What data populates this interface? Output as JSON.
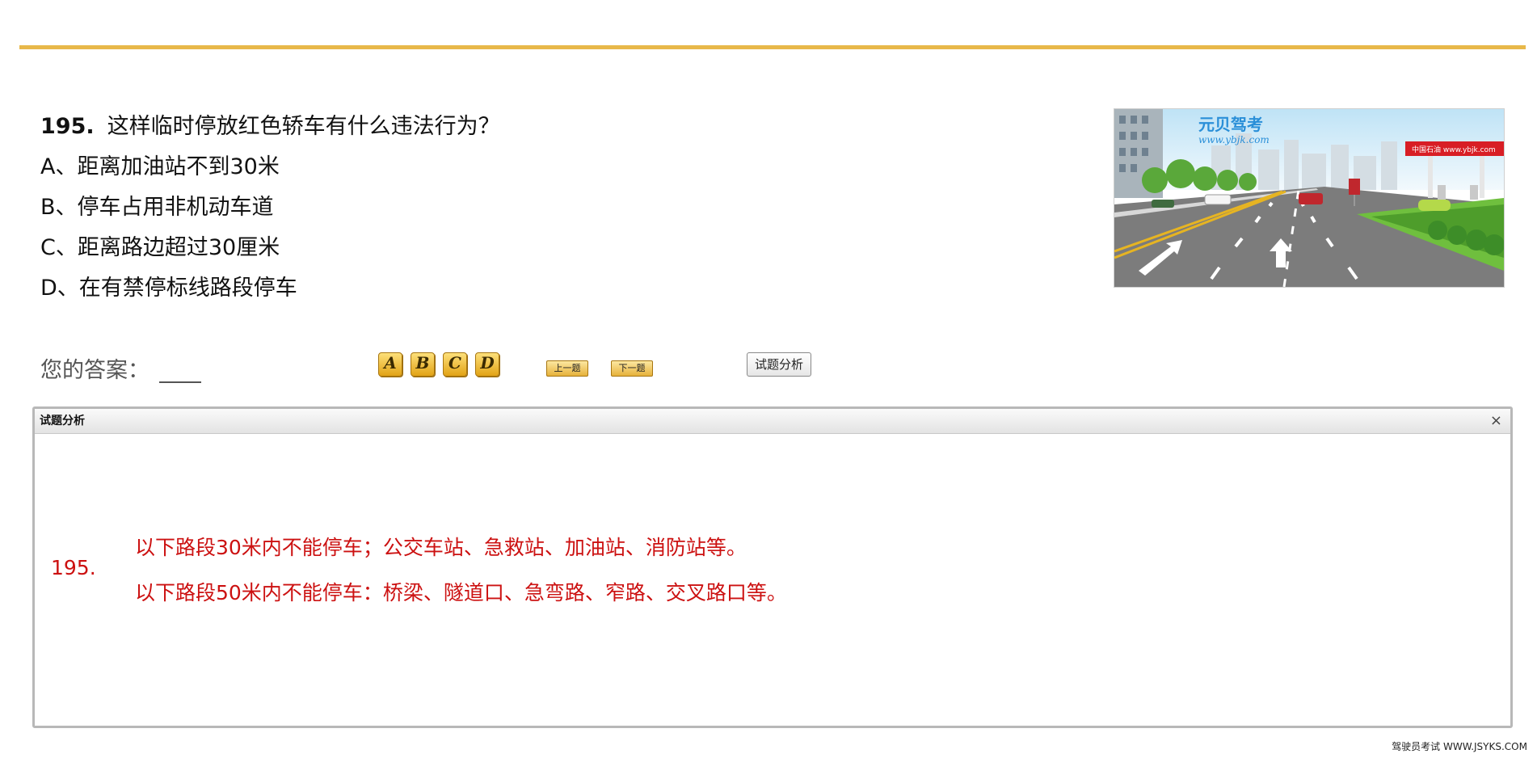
{
  "question": {
    "number": "195.",
    "text": "这样临时停放红色轿车有什么违法行为？",
    "options": [
      "A、距离加油站不到30米",
      "B、停车占用非机动车道",
      "C、距离路边超过30厘米",
      "D、在有禁停标线路段停车"
    ]
  },
  "image": {
    "brand": "元贝驾考",
    "url": "www.ybjk.com",
    "station_sign": "中国石油 www.ybjk.com"
  },
  "answer": {
    "label": "您的答案：",
    "buttons": [
      "A",
      "B",
      "C",
      "D"
    ],
    "prev": "上一题",
    "next": "下一题",
    "analysis": "试题分析"
  },
  "panel": {
    "title": "试题分析",
    "close": "×",
    "number": "195.",
    "lines": [
      "以下路段30米内不能停车；公交车站、急救站、加油站、消防站等。",
      "以下路段50米内不能停车：桥梁、隧道口、急弯路、窄路、交叉路口等。"
    ]
  },
  "footer": "驾驶员考试 WWW.JSYKS.COM",
  "colors": {
    "accent_rule": "#e8b84a",
    "analysis_text": "#cc1111"
  }
}
